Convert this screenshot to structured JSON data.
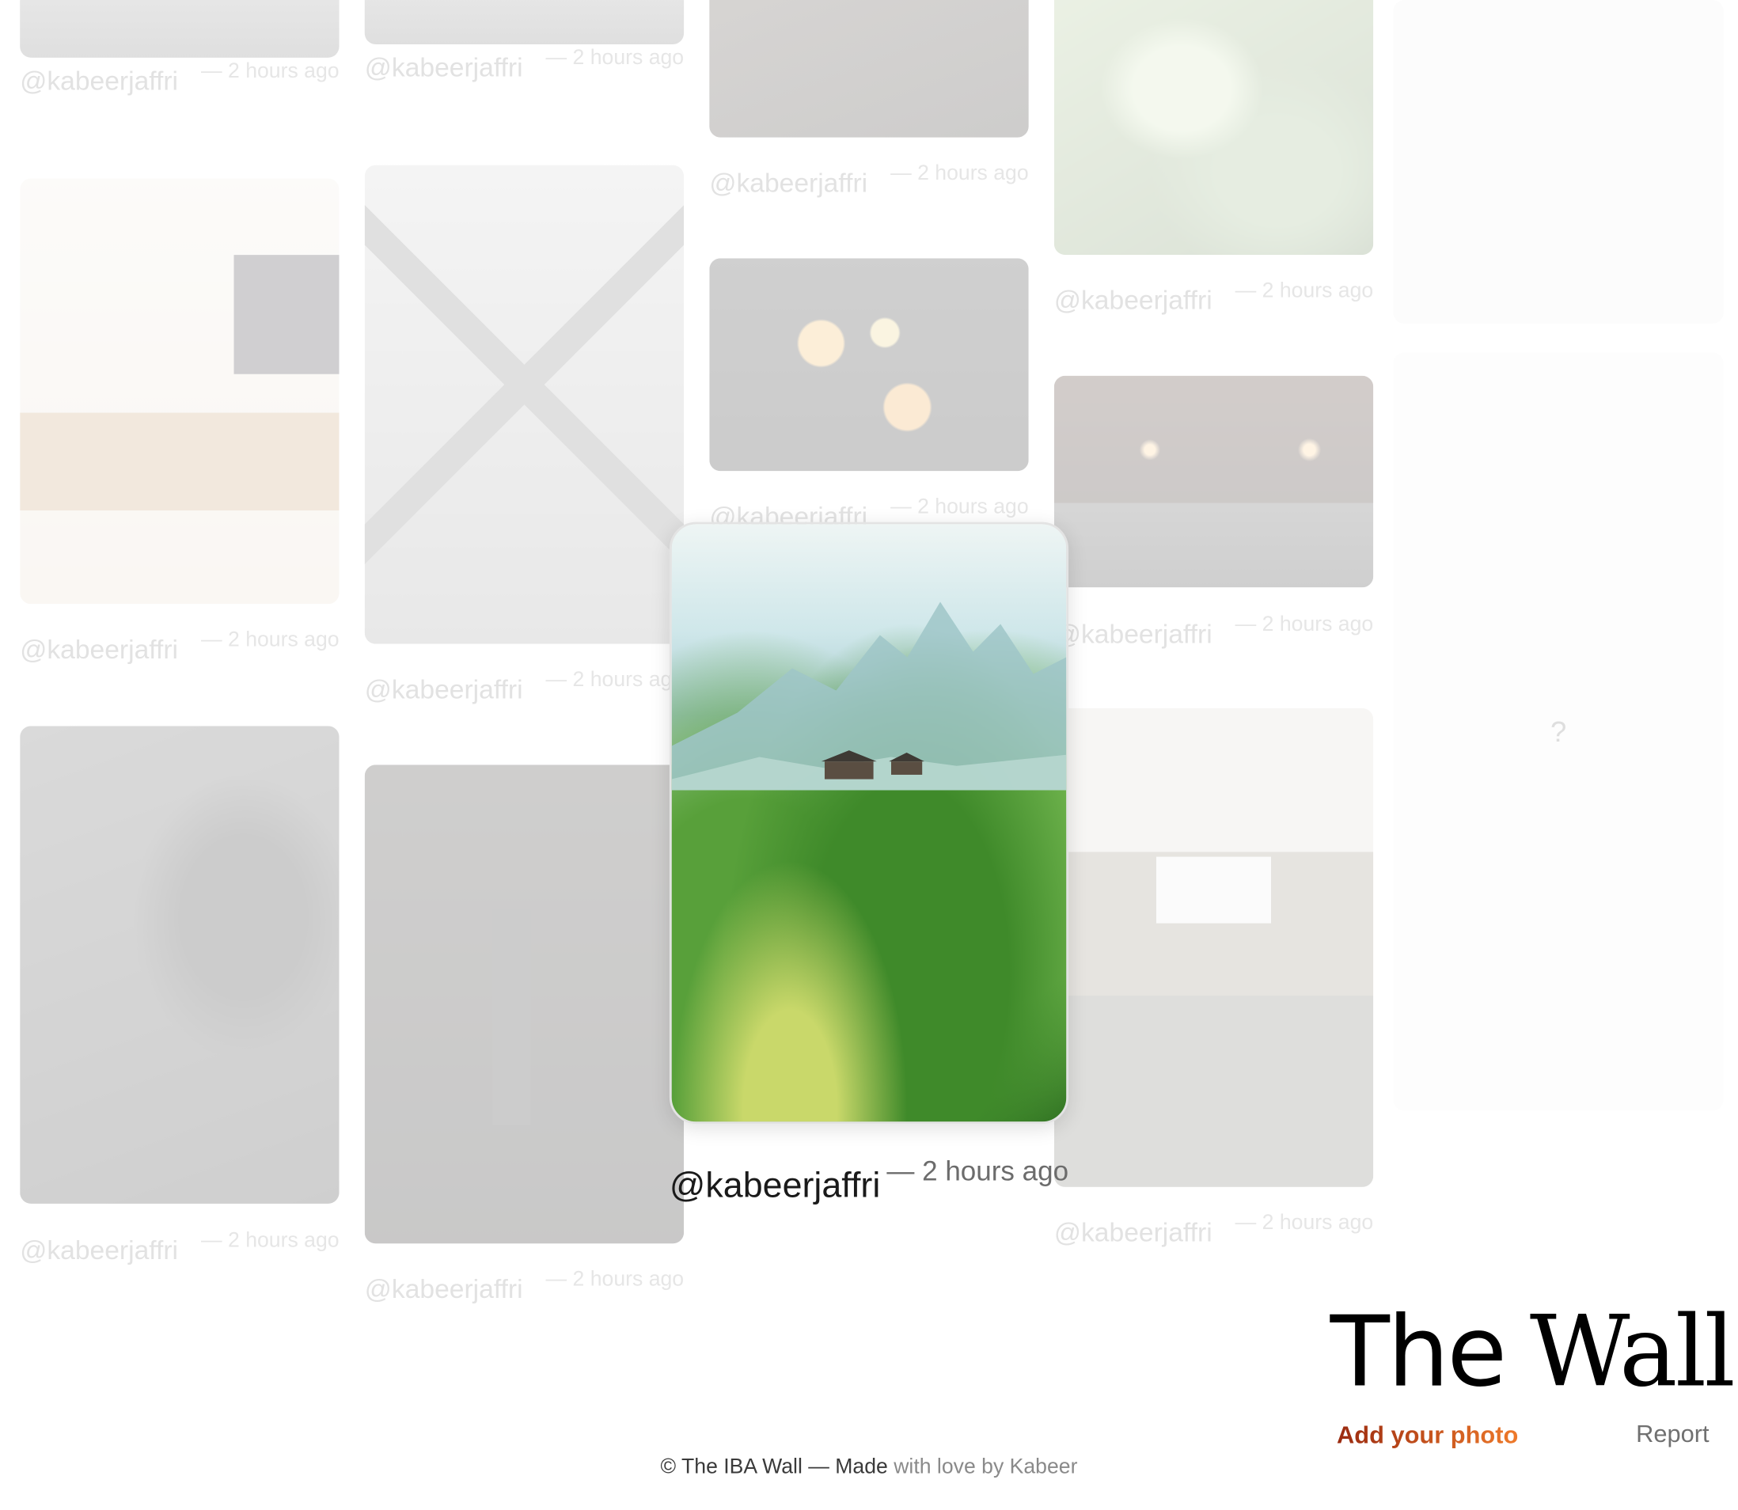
{
  "grid": {
    "cards": [
      {
        "user": "@kabeerjaffri",
        "time": "— 2 hours ago",
        "photo": "gray-abstract"
      },
      {
        "user": "@kabeerjaffri",
        "time": "— 2 hours ago",
        "photo": "gray-abstract"
      },
      {
        "user": "@kabeerjaffri",
        "time": "— 2 hours ago",
        "photo": "dark-interior"
      },
      {
        "user": "@kabeerjaffri",
        "time": "— 2 hours ago",
        "photo": "green-leaf"
      },
      {
        "user": "@kabeerjaffri",
        "time": "— 2 hours ago",
        "photo": "living-room-plants"
      },
      {
        "user": "@kabeerjaffri",
        "time": "— 2 hours ago",
        "photo": "architecture"
      },
      {
        "user": "@kabeerjaffri",
        "time": "— 2 hours ago",
        "photo": "flowers-2025"
      },
      {
        "user": "@kabeerjaffri",
        "time": "— 2 hours ago",
        "photo": "restaurant"
      },
      {
        "user": "@kabeerjaffri",
        "time": "— 2 hours ago",
        "photo": "dog-on-couch"
      },
      {
        "user": "@kabeerjaffri",
        "time": "— 2 hours ago",
        "photo": "wine-bottle"
      },
      {
        "user": "@kabeerjaffri",
        "time": "— 2 hours ago",
        "photo": "white-house-stone-wall"
      }
    ],
    "placeholder_symbol": "?"
  },
  "focused": {
    "user": "@kabeerjaffri",
    "time": "— 2 hours ago",
    "photo": "green-hills-mountains"
  },
  "brand": {
    "title_part1": "The",
    "title_part2": "Wall"
  },
  "actions": {
    "add_photo": "Add your photo",
    "report": "Report"
  },
  "footer": {
    "prefix": "© The IBA Wall — Made ",
    "muted": "with love by Kabeer"
  },
  "colors": {
    "add_photo_gradient_start": "#9a2a10",
    "add_photo_gradient_end": "#ef7a2a"
  }
}
